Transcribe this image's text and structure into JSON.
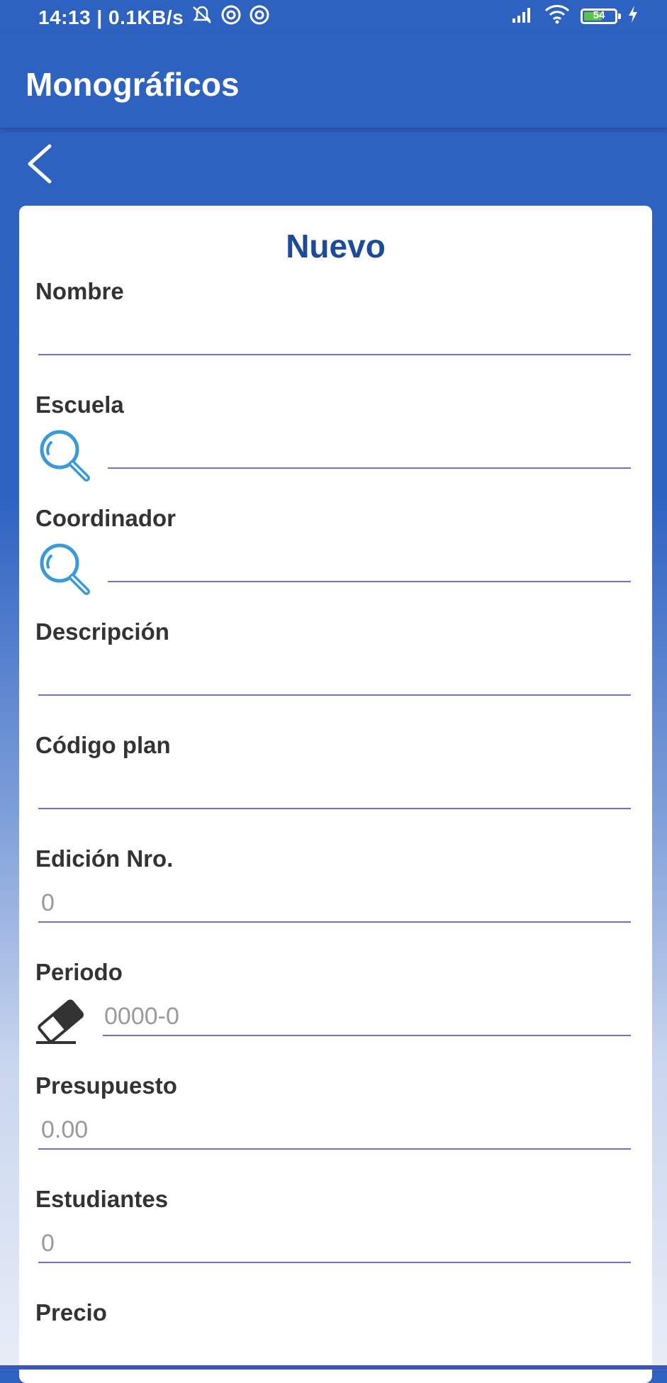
{
  "status": {
    "time_speed": "14:13 | 0.1KB/s",
    "battery": "54"
  },
  "appbar": {
    "title": "Monográficos"
  },
  "form": {
    "title": "Nuevo",
    "fields": [
      {
        "label": "Nombre",
        "value": ""
      },
      {
        "label": "Escuela",
        "value": "",
        "icon": "search-icon"
      },
      {
        "label": "Coordinador",
        "value": "",
        "icon": "search-icon"
      },
      {
        "label": "Descripción",
        "value": ""
      },
      {
        "label": "Código plan",
        "value": ""
      },
      {
        "label": "Edición Nro.",
        "value": "0"
      },
      {
        "label": "Periodo",
        "value": "0000-0",
        "icon": "eraser-icon"
      },
      {
        "label": "Presupuesto",
        "value": "0.00"
      },
      {
        "label": "Estudiantes",
        "value": "0"
      },
      {
        "label": "Precio",
        "value": ""
      }
    ]
  },
  "colors": {
    "primary": "#2d62c0",
    "title": "#1d4a9a",
    "underline": "#6f6fe0",
    "search_icon": "#3a9ad9"
  }
}
